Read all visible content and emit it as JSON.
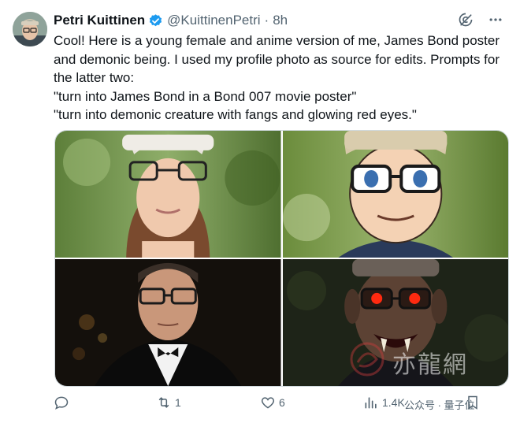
{
  "tweet": {
    "author_name": "Petri Kuittinen",
    "handle": "@KuittinenPetri",
    "separator": "·",
    "time": "8h",
    "lines": [
      "Cool! Here is a young female and anime version of me, James Bond poster",
      "and demonic being. I used my profile photo as source for edits. Prompts for",
      "the latter two:",
      "\"turn into James Bond in a Bond 007 movie poster\"",
      "\"turn into demonic creature with fangs and glowing red eyes.\""
    ]
  },
  "actions": {
    "retweets": "1",
    "likes": "6",
    "views": "1.4K"
  },
  "watermark": {
    "logo_text": "亦龍網",
    "sub_text": "公众号 · 量子位"
  },
  "colors": {
    "verified_blue": "#1d9bf0",
    "muted": "#536471",
    "text": "#0f1419"
  },
  "icons": [
    "verified-icon",
    "grok-icon",
    "more-icon",
    "reply-icon",
    "retweet-icon",
    "like-icon",
    "views-icon",
    "bookmark-icon"
  ]
}
